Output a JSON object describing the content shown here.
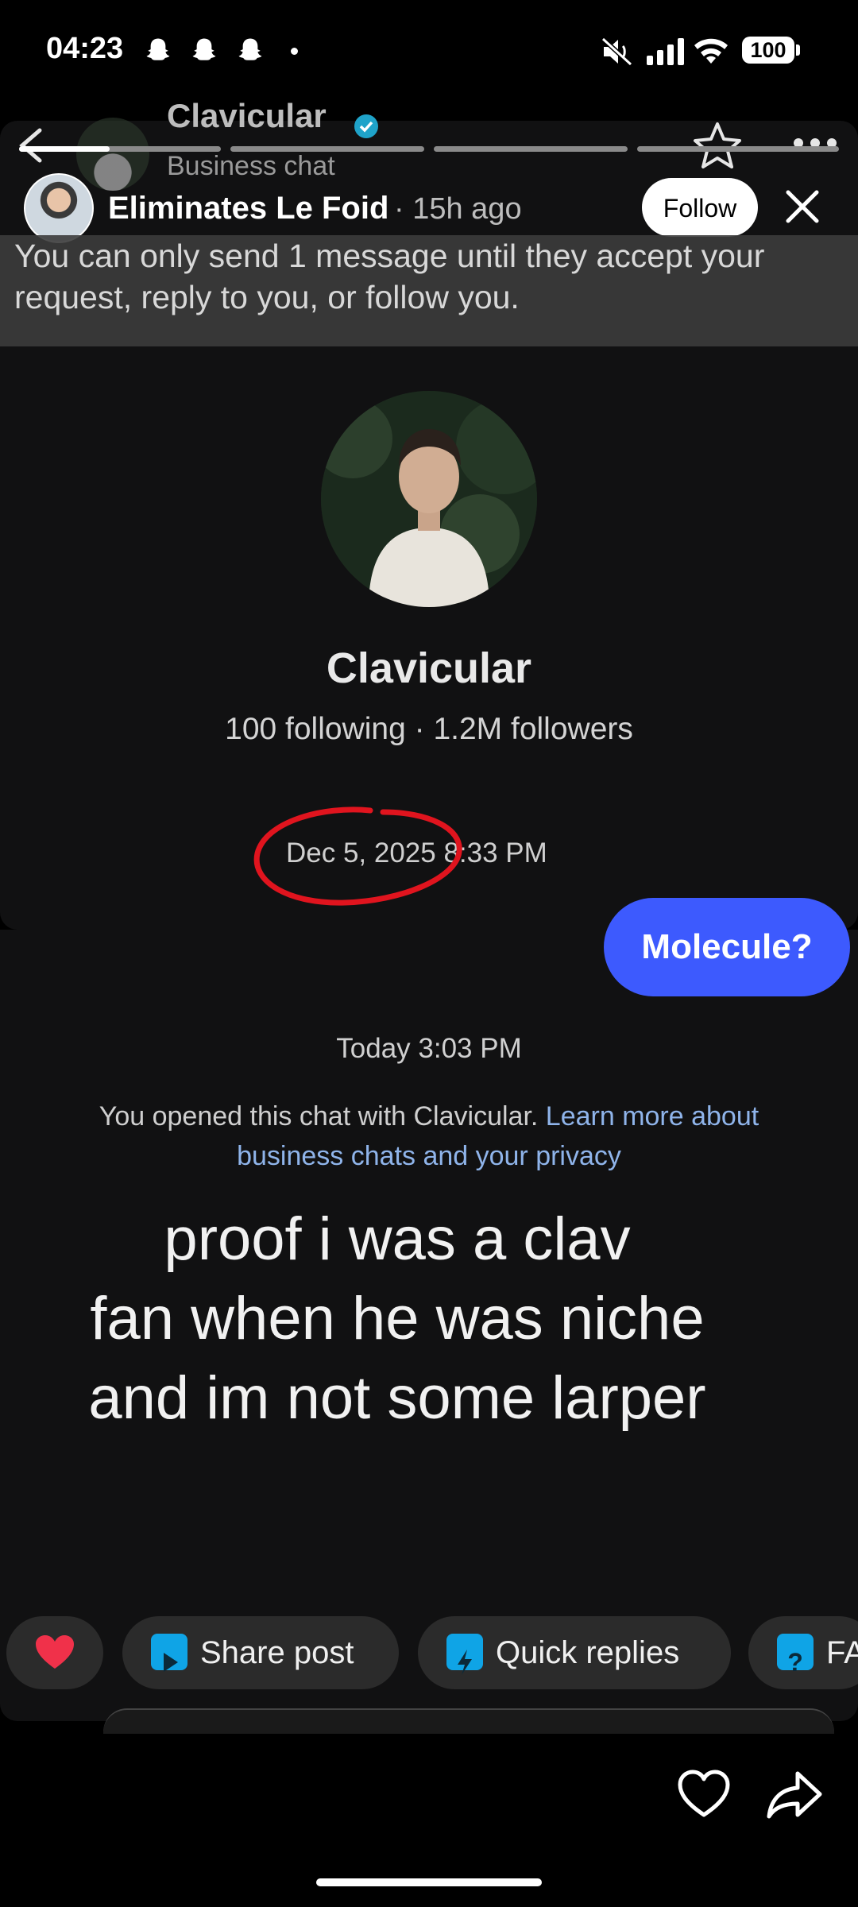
{
  "status_bar": {
    "time": "04:23",
    "notification_icons": [
      "snapchat-ghost-icon",
      "snapchat-ghost-icon",
      "snapchat-ghost-icon"
    ],
    "right_icons": [
      "mute-icon",
      "signal-icon",
      "wifi-icon"
    ],
    "battery": "100"
  },
  "chat_header": {
    "name": "Clavicular",
    "subtitle": "Business chat"
  },
  "story": {
    "username": "Eliminates Le Foid",
    "time_ago": "· 15h ago",
    "follow_label": "Follow",
    "progress_segments": 4,
    "active_segment_progress": 0.45
  },
  "notice": {
    "text": "You can only send 1 message until they accept your request, reply to you, or follow you."
  },
  "profile": {
    "name": "Clavicular",
    "stats": "100 following · 1.2M followers"
  },
  "messages": {
    "timestamp_1": "Dec 5, 2025 8:33 PM",
    "bubble_text": "Molecule?",
    "timestamp_2": "Today 3:03 PM",
    "privacy_text": "You opened this chat with Clavicular.",
    "privacy_link": "Learn more about business chats and your privacy"
  },
  "caption": {
    "line1": "proof i was a clav",
    "line2": "fan when he was niche",
    "line3": "and im not some larper"
  },
  "quick_actions": {
    "share_post": "Share post",
    "quick_replies": "Quick replies",
    "faq_partial": "FA"
  },
  "colors": {
    "bubble": "#3d5afe",
    "link": "#8fb4ea",
    "annotation_circle": "#e0141e",
    "heart": "#f0314a"
  }
}
